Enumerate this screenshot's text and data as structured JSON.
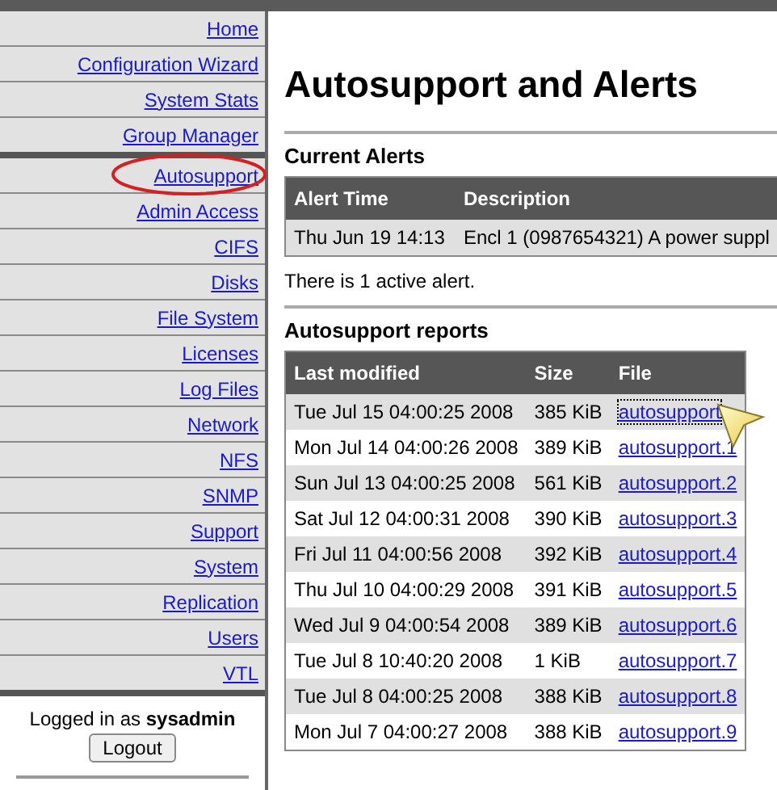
{
  "sidebar": {
    "sections": [
      {
        "items": [
          {
            "label": "Home",
            "circled": false
          },
          {
            "label": "Configuration Wizard",
            "circled": false
          },
          {
            "label": "System Stats",
            "circled": false
          },
          {
            "label": "Group Manager",
            "circled": false
          }
        ]
      },
      {
        "items": [
          {
            "label": "Autosupport",
            "circled": true
          },
          {
            "label": "Admin Access",
            "circled": false
          },
          {
            "label": "CIFS",
            "circled": false
          },
          {
            "label": "Disks",
            "circled": false
          },
          {
            "label": "File System",
            "circled": false
          },
          {
            "label": "Licenses",
            "circled": false
          },
          {
            "label": "Log Files",
            "circled": false
          },
          {
            "label": "Network",
            "circled": false
          },
          {
            "label": "NFS",
            "circled": false
          },
          {
            "label": "SNMP",
            "circled": false
          },
          {
            "label": "Support",
            "circled": false
          },
          {
            "label": "System",
            "circled": false
          },
          {
            "label": "Replication",
            "circled": false
          },
          {
            "label": "Users",
            "circled": false
          },
          {
            "label": "VTL",
            "circled": false
          }
        ]
      }
    ],
    "login": {
      "text": "Logged in as **sysadmin**",
      "button": "Logout"
    }
  },
  "page": {
    "title": "Autosupport and Alerts",
    "alerts": {
      "heading": "Current Alerts",
      "columns": [
        "Alert Time",
        "Description"
      ],
      "rows": [
        [
          "Thu Jun 19 14:13",
          "Encl 1 (0987654321) A power suppl"
        ]
      ],
      "summary": "There is 1 active alert."
    },
    "reports": {
      "heading": "Autosupport reports",
      "columns": [
        "Last modified",
        "Size",
        "File"
      ],
      "rows": [
        {
          "modified": "Tue Jul 15 04:00:25 2008",
          "size": "385 KiB",
          "file": "autosupport",
          "focused": true
        },
        {
          "modified": "Mon Jul 14 04:00:26 2008",
          "size": "389 KiB",
          "file": "autosupport.1",
          "focused": false
        },
        {
          "modified": "Sun Jul 13 04:00:25 2008",
          "size": "561 KiB",
          "file": "autosupport.2",
          "focused": false
        },
        {
          "modified": "Sat Jul 12 04:00:31 2008",
          "size": "390 KiB",
          "file": "autosupport.3",
          "focused": false
        },
        {
          "modified": "Fri Jul 11 04:00:56 2008",
          "size": "392 KiB",
          "file": "autosupport.4",
          "focused": false
        },
        {
          "modified": "Thu Jul 10 04:00:29 2008",
          "size": "391 KiB",
          "file": "autosupport.5",
          "focused": false
        },
        {
          "modified": "Wed Jul 9 04:00:54 2008",
          "size": "389 KiB",
          "file": "autosupport.6",
          "focused": false
        },
        {
          "modified": "Tue Jul 8 10:40:20 2008",
          "size": "1 KiB",
          "file": "autosupport.7",
          "focused": false
        },
        {
          "modified": "Tue Jul 8 04:00:25 2008",
          "size": "388 KiB",
          "file": "autosupport.8",
          "focused": false
        },
        {
          "modified": "Mon Jul 7 04:00:27 2008",
          "size": "388 KiB",
          "file": "autosupport.9",
          "focused": false
        }
      ]
    }
  }
}
